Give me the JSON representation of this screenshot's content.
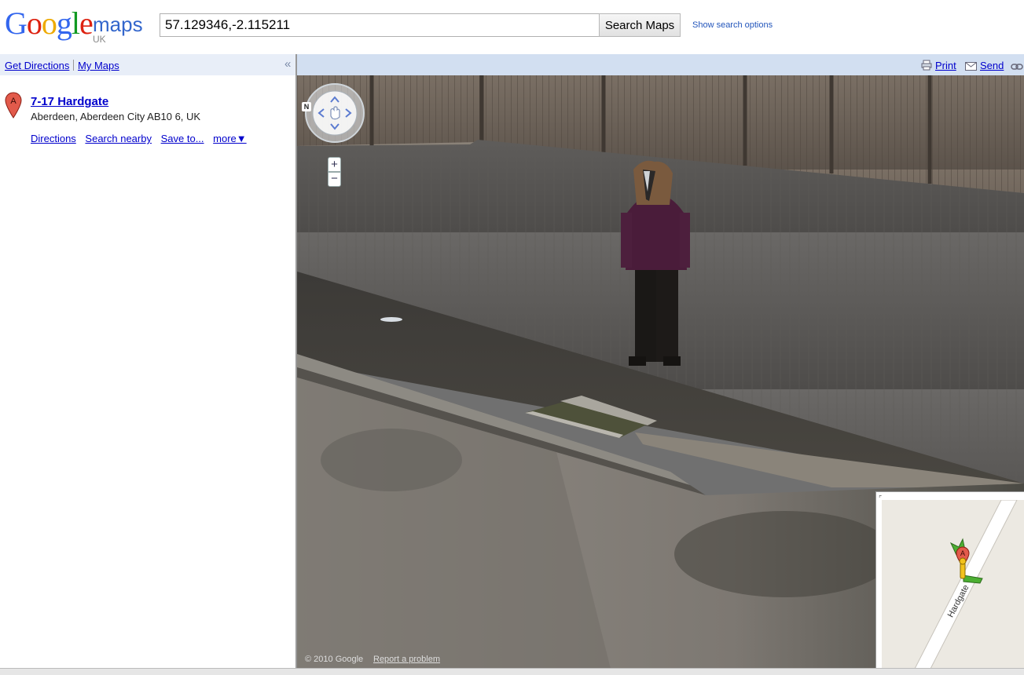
{
  "header": {
    "logo_google": [
      "G",
      "o",
      "o",
      "g",
      "l",
      "e"
    ],
    "logo_maps": "maps",
    "logo_region": "UK",
    "search_value": "57.129346,-2.115211",
    "search_button": "Search Maps",
    "show_options": "Show search options"
  },
  "left_panel": {
    "get_directions": "Get Directions",
    "my_maps": "My Maps",
    "collapse_icon": "«",
    "result": {
      "marker_letter": "A",
      "title": "7-17 Hardgate",
      "address": "Aberdeen, Aberdeen City AB10 6, UK",
      "actions": [
        "Directions",
        "Search nearby",
        "Save to...",
        "more▼"
      ]
    }
  },
  "map_toolbar": {
    "print": "Print",
    "send": "Send"
  },
  "streetview": {
    "compass_letter": "N",
    "zoom_in": "+",
    "zoom_out": "−",
    "copyright": "© 2010 Google",
    "report_problem": "Report a problem"
  },
  "minimap": {
    "marker_letter": "A",
    "street_name": "Hardgate"
  },
  "colors": {
    "accent_link": "#0000cc",
    "toolbar_blue": "#d2dff1",
    "left_bar": "#e8eef8",
    "marker_red": "#e25a4b",
    "pegman_green": "#4caf32",
    "pegman_yellow": "#f2c21d"
  },
  "icons": [
    "print-icon",
    "mail-icon",
    "link-icon",
    "navigation-control-icon",
    "map-marker-icon",
    "pegman-icon",
    "collapse-icon"
  ]
}
